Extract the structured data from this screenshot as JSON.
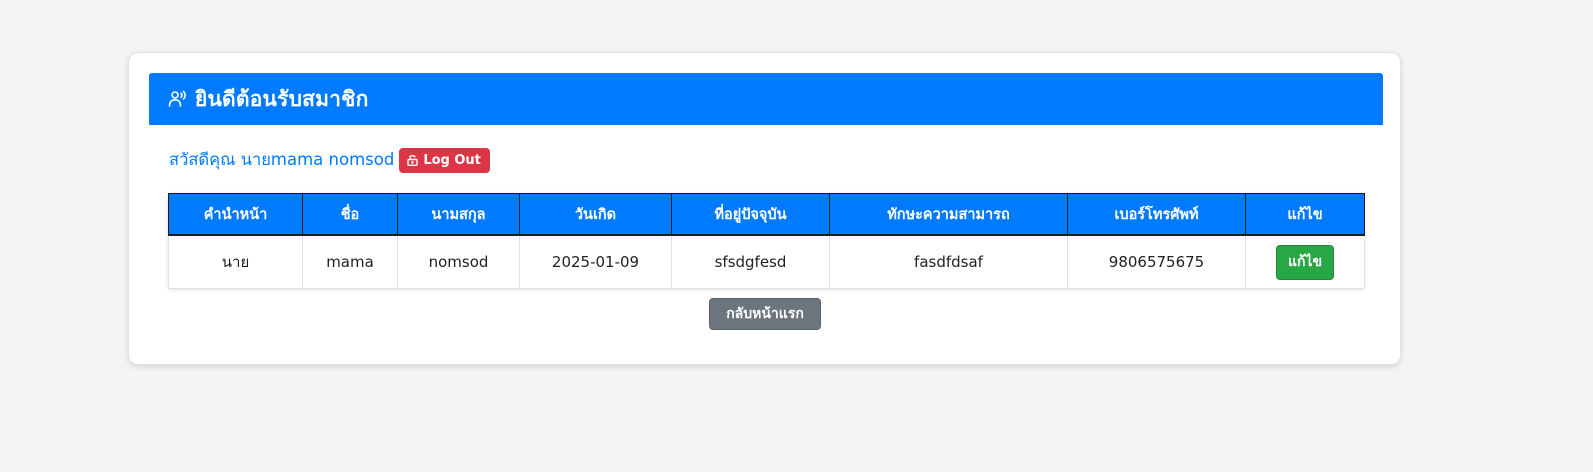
{
  "header": {
    "icon": "user-voice-icon",
    "title": "ยินดีต้อนรับสมาชิก"
  },
  "greeting": {
    "text": "สวัสดีคุณ นายmama nomsod",
    "logout_icon": "unlock-icon",
    "logout_label": "Log Out"
  },
  "table": {
    "headers": [
      "คำนำหน้า",
      "ชื่อ",
      "นามสกุล",
      "วันเกิด",
      "ที่อยู่ปัจจุบัน",
      "ทักษะความสามารถ",
      "เบอร์โทรศัพท์",
      "แก้ไข"
    ],
    "rows": [
      {
        "prefix": "นาย",
        "first_name": "mama",
        "last_name": "nomsod",
        "birthdate": "2025-01-09",
        "address": "sfsdgfesd",
        "skills": "fasdfdsaf",
        "phone": "9806575675",
        "edit_label": "แก้ไข"
      }
    ]
  },
  "colors": {
    "primary": "#007bff",
    "danger": "#dc3545",
    "success": "#28a745",
    "secondary": "#6c757d"
  },
  "back_button": {
    "label": "กลับหน้าแรก"
  }
}
